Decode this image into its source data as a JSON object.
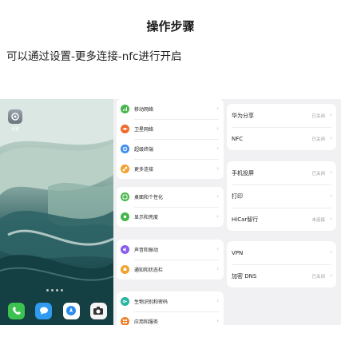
{
  "header": {
    "title": "操作步骤",
    "instruction": "可以通过设置-更多连接-nfc进行开启"
  },
  "home": {
    "settings_app_label": "设置"
  },
  "menu": {
    "groups": [
      {
        "items": [
          {
            "label": "移动网络",
            "icon": "antenna-icon",
            "color": "#46b64c"
          },
          {
            "label": "卫星网络",
            "icon": "satellite-icon",
            "color": "#f06a2c"
          },
          {
            "label": "超级终端",
            "icon": "super-device-icon",
            "color": "#3d8cf0"
          },
          {
            "label": "更多连接",
            "icon": "link-icon",
            "color": "#f2a12b"
          }
        ]
      },
      {
        "items": [
          {
            "label": "桌面和个性化",
            "icon": "desktop-icon",
            "color": "#46b64c"
          },
          {
            "label": "显示和亮度",
            "icon": "brightness-icon",
            "color": "#46b64c"
          }
        ]
      },
      {
        "items": [
          {
            "label": "声音和振动",
            "icon": "speaker-icon",
            "color": "#8a5cf0"
          },
          {
            "label": "通知和状态栏",
            "icon": "bell-icon",
            "color": "#f2a12b"
          }
        ]
      },
      {
        "items": [
          {
            "label": "生物识别和密码",
            "icon": "key-icon",
            "color": "#2ab3a3"
          },
          {
            "label": "应用和服务",
            "icon": "apps-icon",
            "color": "#f0812c"
          }
        ]
      }
    ]
  },
  "detail": {
    "groups": [
      {
        "items": [
          {
            "label": "华为分享",
            "value": "已关闭"
          },
          {
            "label": "NFC",
            "value": "已关闭"
          }
        ]
      },
      {
        "items": [
          {
            "label": "手机投屏",
            "value": "已关闭"
          },
          {
            "label": "打印",
            "value": ""
          },
          {
            "label": "HiCar智行",
            "value": "未连接"
          }
        ]
      },
      {
        "items": [
          {
            "label": "VPN",
            "value": ""
          },
          {
            "label": "加密 DNS",
            "value": "已关闭"
          }
        ]
      }
    ]
  }
}
